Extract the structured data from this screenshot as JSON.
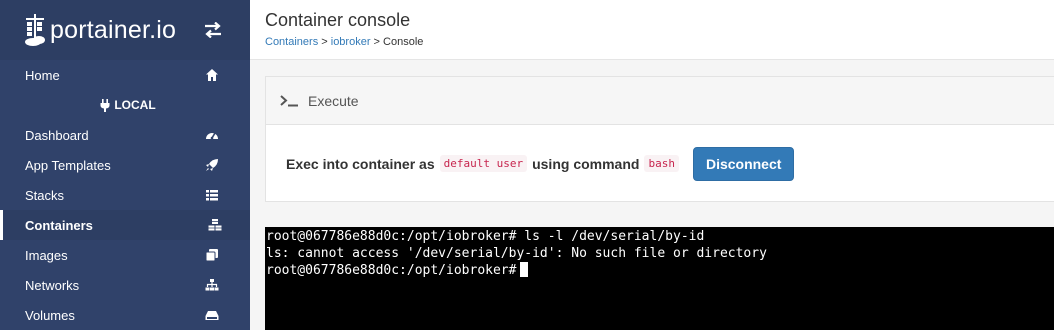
{
  "sidebar": {
    "brand": "portainer.io",
    "items_top": [
      {
        "label": "Home",
        "icon": "home-icon"
      }
    ],
    "endpoint": "LOCAL",
    "items": [
      {
        "label": "Dashboard",
        "icon": "tachometer-icon"
      },
      {
        "label": "App Templates",
        "icon": "rocket-icon"
      },
      {
        "label": "Stacks",
        "icon": "list-icon"
      },
      {
        "label": "Containers",
        "icon": "cubes-icon",
        "active": true
      },
      {
        "label": "Images",
        "icon": "clone-icon"
      },
      {
        "label": "Networks",
        "icon": "sitemap-icon"
      },
      {
        "label": "Volumes",
        "icon": "hdd-icon"
      }
    ]
  },
  "header": {
    "title": "Container console",
    "breadcrumb": {
      "containers": "Containers",
      "sep1": " > ",
      "container": "iobroker",
      "sep2": " > ",
      "current": "Console"
    }
  },
  "panel": {
    "title": "Execute",
    "exec_prefix": "Exec into container as",
    "user": "default user",
    "using": "using command",
    "command": "bash",
    "disconnect_label": "Disconnect"
  },
  "terminal": {
    "lines": [
      "root@067786e88d0c:/opt/iobroker# ls -l /dev/serial/by-id",
      "ls: cannot access '/dev/serial/by-id': No such file or directory",
      "root@067786e88d0c:/opt/iobroker#"
    ]
  },
  "colors": {
    "sidebar_bg": "#30426a",
    "primary": "#337ab7",
    "code_text": "#c7254e"
  }
}
